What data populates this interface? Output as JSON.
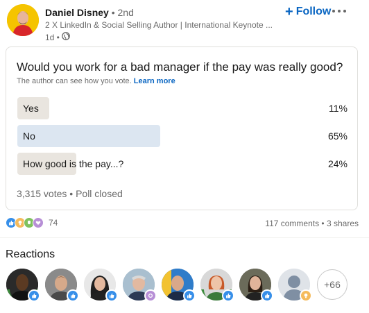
{
  "post": {
    "author_name": "Daniel Disney",
    "author_degree": " • 2nd",
    "headline": "2 X LinkedIn & Social Selling Author | International Keynote ...",
    "timestamp": "1d •",
    "follow_label": "Follow"
  },
  "poll": {
    "question": "Would you work for a bad manager if the pay was really good?",
    "privacy_note": "The author can see how you vote.",
    "learn_more": "Learn more",
    "options": [
      {
        "label": "Yes",
        "percent": "11%",
        "fraction": 0.11
      },
      {
        "label": "No",
        "percent": "65%",
        "fraction": 0.65
      },
      {
        "label": "How good is the pay...?",
        "percent": "24%",
        "fraction": 0.24
      }
    ],
    "footer": "3,315 votes • Poll closed"
  },
  "social": {
    "reaction_count": "74",
    "comments": "117 comments",
    "separator": " • ",
    "shares": "3 shares"
  },
  "reactions": {
    "title": "Reactions",
    "more_count": "+66"
  },
  "colors": {
    "accent": "#0a66c2",
    "winning_bar": "#dce6f1",
    "bar": "#e9e5df"
  }
}
